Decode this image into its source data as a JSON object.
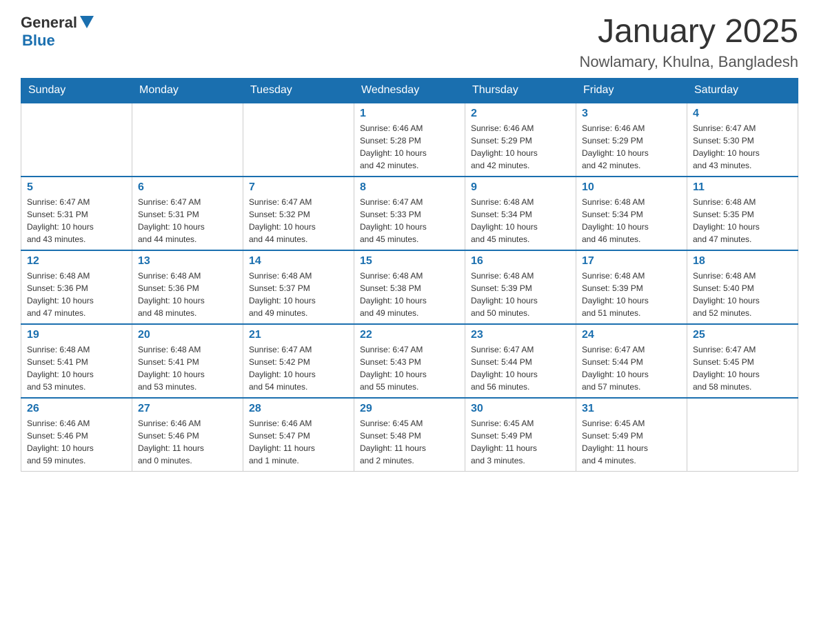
{
  "header": {
    "logo_general": "General",
    "logo_blue": "Blue",
    "month_title": "January 2025",
    "location": "Nowlamary, Khulna, Bangladesh"
  },
  "weekdays": [
    "Sunday",
    "Monday",
    "Tuesday",
    "Wednesday",
    "Thursday",
    "Friday",
    "Saturday"
  ],
  "weeks": [
    [
      {
        "day": "",
        "info": ""
      },
      {
        "day": "",
        "info": ""
      },
      {
        "day": "",
        "info": ""
      },
      {
        "day": "1",
        "info": "Sunrise: 6:46 AM\nSunset: 5:28 PM\nDaylight: 10 hours\nand 42 minutes."
      },
      {
        "day": "2",
        "info": "Sunrise: 6:46 AM\nSunset: 5:29 PM\nDaylight: 10 hours\nand 42 minutes."
      },
      {
        "day": "3",
        "info": "Sunrise: 6:46 AM\nSunset: 5:29 PM\nDaylight: 10 hours\nand 42 minutes."
      },
      {
        "day": "4",
        "info": "Sunrise: 6:47 AM\nSunset: 5:30 PM\nDaylight: 10 hours\nand 43 minutes."
      }
    ],
    [
      {
        "day": "5",
        "info": "Sunrise: 6:47 AM\nSunset: 5:31 PM\nDaylight: 10 hours\nand 43 minutes."
      },
      {
        "day": "6",
        "info": "Sunrise: 6:47 AM\nSunset: 5:31 PM\nDaylight: 10 hours\nand 44 minutes."
      },
      {
        "day": "7",
        "info": "Sunrise: 6:47 AM\nSunset: 5:32 PM\nDaylight: 10 hours\nand 44 minutes."
      },
      {
        "day": "8",
        "info": "Sunrise: 6:47 AM\nSunset: 5:33 PM\nDaylight: 10 hours\nand 45 minutes."
      },
      {
        "day": "9",
        "info": "Sunrise: 6:48 AM\nSunset: 5:34 PM\nDaylight: 10 hours\nand 45 minutes."
      },
      {
        "day": "10",
        "info": "Sunrise: 6:48 AM\nSunset: 5:34 PM\nDaylight: 10 hours\nand 46 minutes."
      },
      {
        "day": "11",
        "info": "Sunrise: 6:48 AM\nSunset: 5:35 PM\nDaylight: 10 hours\nand 47 minutes."
      }
    ],
    [
      {
        "day": "12",
        "info": "Sunrise: 6:48 AM\nSunset: 5:36 PM\nDaylight: 10 hours\nand 47 minutes."
      },
      {
        "day": "13",
        "info": "Sunrise: 6:48 AM\nSunset: 5:36 PM\nDaylight: 10 hours\nand 48 minutes."
      },
      {
        "day": "14",
        "info": "Sunrise: 6:48 AM\nSunset: 5:37 PM\nDaylight: 10 hours\nand 49 minutes."
      },
      {
        "day": "15",
        "info": "Sunrise: 6:48 AM\nSunset: 5:38 PM\nDaylight: 10 hours\nand 49 minutes."
      },
      {
        "day": "16",
        "info": "Sunrise: 6:48 AM\nSunset: 5:39 PM\nDaylight: 10 hours\nand 50 minutes."
      },
      {
        "day": "17",
        "info": "Sunrise: 6:48 AM\nSunset: 5:39 PM\nDaylight: 10 hours\nand 51 minutes."
      },
      {
        "day": "18",
        "info": "Sunrise: 6:48 AM\nSunset: 5:40 PM\nDaylight: 10 hours\nand 52 minutes."
      }
    ],
    [
      {
        "day": "19",
        "info": "Sunrise: 6:48 AM\nSunset: 5:41 PM\nDaylight: 10 hours\nand 53 minutes."
      },
      {
        "day": "20",
        "info": "Sunrise: 6:48 AM\nSunset: 5:41 PM\nDaylight: 10 hours\nand 53 minutes."
      },
      {
        "day": "21",
        "info": "Sunrise: 6:47 AM\nSunset: 5:42 PM\nDaylight: 10 hours\nand 54 minutes."
      },
      {
        "day": "22",
        "info": "Sunrise: 6:47 AM\nSunset: 5:43 PM\nDaylight: 10 hours\nand 55 minutes."
      },
      {
        "day": "23",
        "info": "Sunrise: 6:47 AM\nSunset: 5:44 PM\nDaylight: 10 hours\nand 56 minutes."
      },
      {
        "day": "24",
        "info": "Sunrise: 6:47 AM\nSunset: 5:44 PM\nDaylight: 10 hours\nand 57 minutes."
      },
      {
        "day": "25",
        "info": "Sunrise: 6:47 AM\nSunset: 5:45 PM\nDaylight: 10 hours\nand 58 minutes."
      }
    ],
    [
      {
        "day": "26",
        "info": "Sunrise: 6:46 AM\nSunset: 5:46 PM\nDaylight: 10 hours\nand 59 minutes."
      },
      {
        "day": "27",
        "info": "Sunrise: 6:46 AM\nSunset: 5:46 PM\nDaylight: 11 hours\nand 0 minutes."
      },
      {
        "day": "28",
        "info": "Sunrise: 6:46 AM\nSunset: 5:47 PM\nDaylight: 11 hours\nand 1 minute."
      },
      {
        "day": "29",
        "info": "Sunrise: 6:45 AM\nSunset: 5:48 PM\nDaylight: 11 hours\nand 2 minutes."
      },
      {
        "day": "30",
        "info": "Sunrise: 6:45 AM\nSunset: 5:49 PM\nDaylight: 11 hours\nand 3 minutes."
      },
      {
        "day": "31",
        "info": "Sunrise: 6:45 AM\nSunset: 5:49 PM\nDaylight: 11 hours\nand 4 minutes."
      },
      {
        "day": "",
        "info": ""
      }
    ]
  ]
}
